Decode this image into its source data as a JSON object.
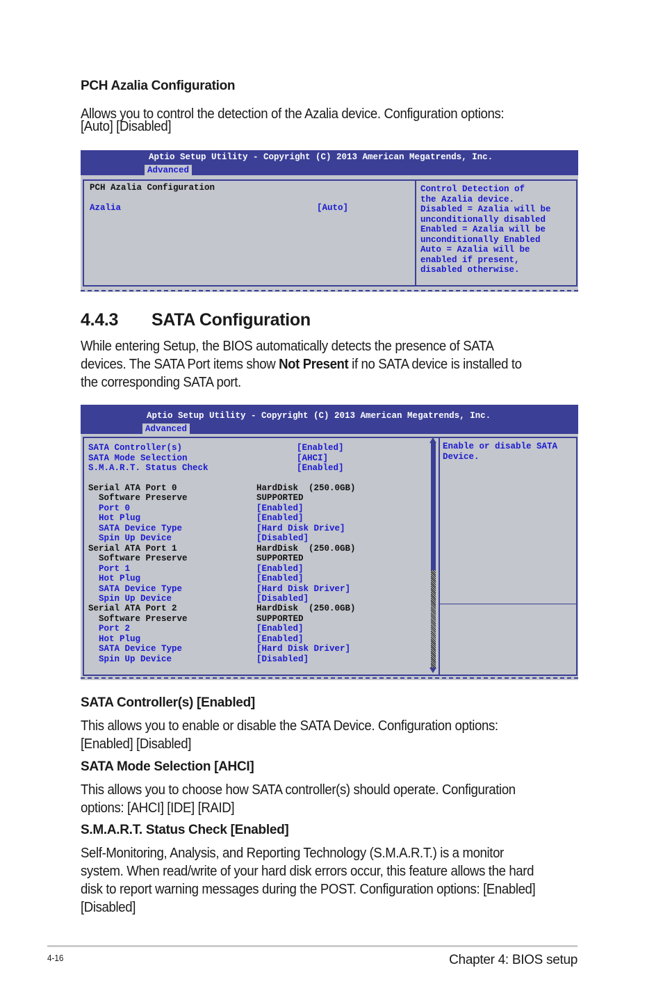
{
  "section_azalia": {
    "heading": "PCH Azalia Configuration",
    "body_line1": "Allows you to control the detection of the Azalia device. Configuration options:",
    "body_line2": "[Auto] [Disabled]"
  },
  "bios1": {
    "title": "Aptio Setup Utility - Copyright (C) 2013 American Megatrends, Inc.",
    "tab": "Advanced",
    "section_label": "PCH Azalia Configuration",
    "items": [
      {
        "label": "Azalia",
        "value": "[Auto]"
      }
    ],
    "help": [
      "Control Detection of",
      "the Azalia device.",
      "Disabled = Azalia will be",
      "unconditionally disabled",
      "Enabled = Azalia will be",
      "unconditionally Enabled",
      "Auto = Azalia will be",
      "enabled if present,",
      "disabled otherwise."
    ]
  },
  "section_sata": {
    "number": "4.4.3",
    "title": "SATA Configuration",
    "intro_line1": "While entering Setup, the BIOS automatically detects the presence of SATA",
    "intro_line2_pre": "devices. The SATA Port items show ",
    "intro_line2_bold": "Not Present",
    "intro_line2_post": " if no SATA device is installed to",
    "intro_line3": "the corresponding SATA port."
  },
  "bios2": {
    "title": "Aptio Setup Utility - Copyright (C) 2013 American Megatrends, Inc.",
    "tab": "Advanced",
    "top_items": [
      {
        "label": "SATA Controller(s)",
        "value": "[Enabled]"
      },
      {
        "label": "SATA Mode Selection",
        "value": "[AHCI]"
      },
      {
        "label": "S.M.A.R.T. Status Check",
        "value": "[Enabled]"
      }
    ],
    "rows": [
      {
        "label": "Serial ATA Port 0",
        "value": "HardDisk  (250.0GB)",
        "kind": "header"
      },
      {
        "label": "  Software Preserve",
        "value": "SUPPORTED",
        "kind": "info"
      },
      {
        "label": "  Port 0",
        "value": "[Enabled]",
        "kind": "option"
      },
      {
        "label": "  Hot Plug",
        "value": "[Enabled]",
        "kind": "option"
      },
      {
        "label": "  SATA Device Type",
        "value": "[Hard Disk Drive]",
        "kind": "option"
      },
      {
        "label": "  Spin Up Device",
        "value": "[Disabled]",
        "kind": "option"
      },
      {
        "label": "Serial ATA Port 1",
        "value": "HardDisk  (250.0GB)",
        "kind": "header"
      },
      {
        "label": "  Software Preserve",
        "value": "SUPPORTED",
        "kind": "info"
      },
      {
        "label": "  Port 1",
        "value": "[Enabled]",
        "kind": "option"
      },
      {
        "label": "  Hot Plug",
        "value": "[Enabled]",
        "kind": "option"
      },
      {
        "label": "  SATA Device Type",
        "value": "[Hard Disk Driver]",
        "kind": "option"
      },
      {
        "label": "  Spin Up Device",
        "value": "[Disabled]",
        "kind": "option"
      },
      {
        "label": "Serial ATA Port 2",
        "value": "HardDisk  (250.0GB)",
        "kind": "header"
      },
      {
        "label": "  Software Preserve",
        "value": "SUPPORTED",
        "kind": "info"
      },
      {
        "label": "  Port 2",
        "value": "[Enabled]",
        "kind": "option"
      },
      {
        "label": "  Hot Plug",
        "value": "[Enabled]",
        "kind": "option"
      },
      {
        "label": "  SATA Device Type",
        "value": "[Hard Disk Driver]",
        "kind": "option"
      },
      {
        "label": "  Spin Up Device",
        "value": "[Disabled]",
        "kind": "option"
      }
    ],
    "help": [
      "Enable or disable SATA",
      "Device."
    ]
  },
  "descriptions": [
    {
      "heading": "SATA Controller(s) [Enabled]",
      "lines": [
        "This allows you to enable or disable the SATA Device. Configuration options:",
        "[Enabled] [Disabled]"
      ]
    },
    {
      "heading": "SATA Mode Selection [AHCI]",
      "lines": [
        "This allows you to choose how SATA controller(s) should operate. Configuration",
        "options: [AHCI] [IDE] [RAID]"
      ]
    },
    {
      "heading": "S.M.A.R.T. Status Check [Enabled]",
      "lines": [
        "Self-Monitoring, Analysis, and Reporting Technology (S.M.A.R.T.) is a monitor",
        "system. When read/write of your hard disk errors occur, this feature allows the hard",
        "disk to report warning messages during the POST. Configuration options: [Enabled]",
        "[Disabled]"
      ]
    }
  ],
  "footer": {
    "page_number": "4-16",
    "chapter": "Chapter 4: BIOS setup"
  }
}
